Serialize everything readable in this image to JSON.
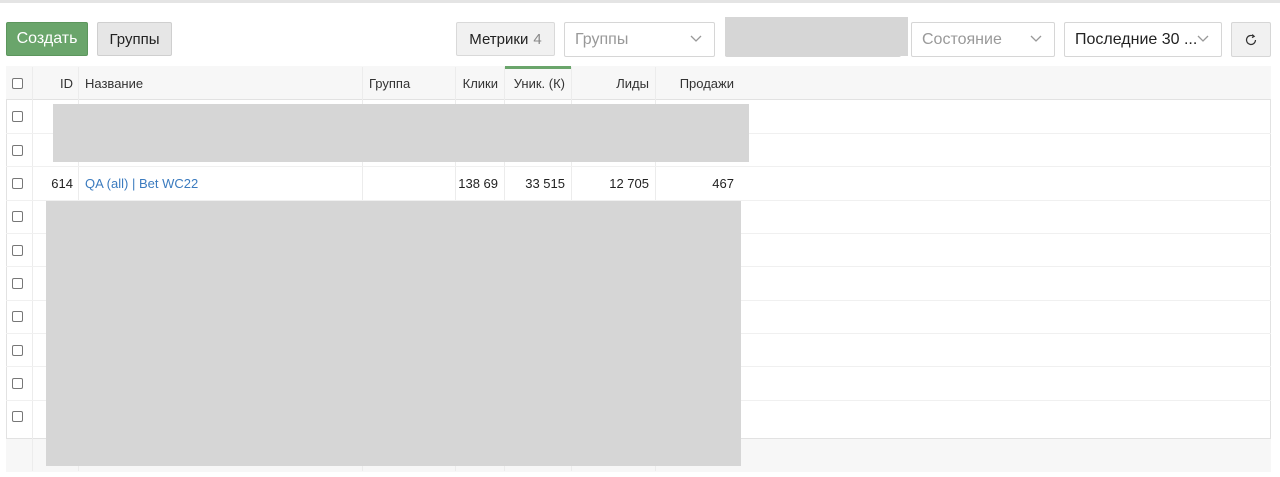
{
  "toolbar": {
    "create_label": "Создать",
    "groups_label": "Группы",
    "metrics_label": "Метрики",
    "metrics_count": "4",
    "groups_select_placeholder": "Группы",
    "state_select_placeholder": "Состояние",
    "period_select_value": "Последние 30 ..."
  },
  "table": {
    "columns": {
      "id": "ID",
      "name": "Название",
      "group": "Группа",
      "clicks": "Клики",
      "unique": "Уник. (К)",
      "leads": "Лиды",
      "sales": "Продажи"
    },
    "row": {
      "id": "614",
      "name": "QA (all) | Bet WC22",
      "clicks": "138 69",
      "unique": "33 515",
      "leads": "12 705",
      "sales": "467"
    }
  },
  "icons": {
    "refresh": "refresh-icon",
    "chevron": "chevron-down-icon",
    "checkbox": "checkbox"
  },
  "colors": {
    "accent": "#6aa56b",
    "link": "#3b7bbf",
    "redaction": "#d6d6d6"
  }
}
